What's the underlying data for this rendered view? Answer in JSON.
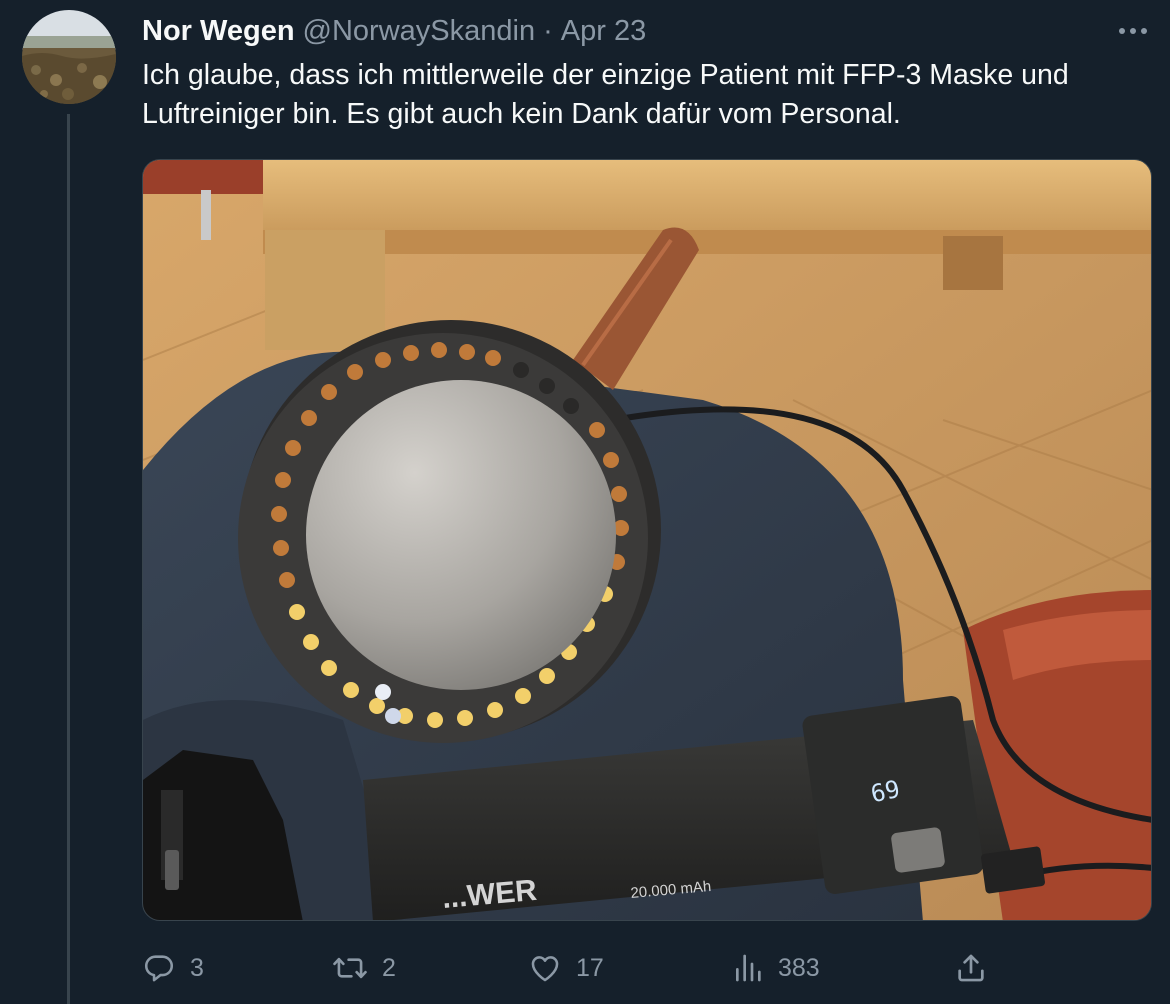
{
  "tweet": {
    "display_name": "Nor Wegen",
    "handle": "@NorwaySkandin",
    "separator": "·",
    "date": "Apr 23",
    "text": "Ich glaube, dass ich mittlerweile der einzige Patient mit FFP-3 Maske und Luftreiniger bin. Es gibt auch kein Dank dafür vom Personal.",
    "avatar_icon": "landscape-avatar",
    "more_icon": "more-dots-icon"
  },
  "media": {
    "powerbank_brand": "...WER",
    "powerbank_capacity": "20.000 mAh",
    "display_digits": "69"
  },
  "actions": {
    "reply": {
      "icon": "reply-icon",
      "count": "3"
    },
    "retweet": {
      "icon": "retweet-icon",
      "count": "2"
    },
    "like": {
      "icon": "heart-icon",
      "count": "17"
    },
    "views": {
      "icon": "views-icon",
      "count": "383"
    },
    "share": {
      "icon": "share-icon"
    }
  },
  "colors": {
    "background": "#15202b",
    "text_primary": "#f7f9f9",
    "text_secondary": "#8b98a5",
    "border": "#38444d"
  }
}
